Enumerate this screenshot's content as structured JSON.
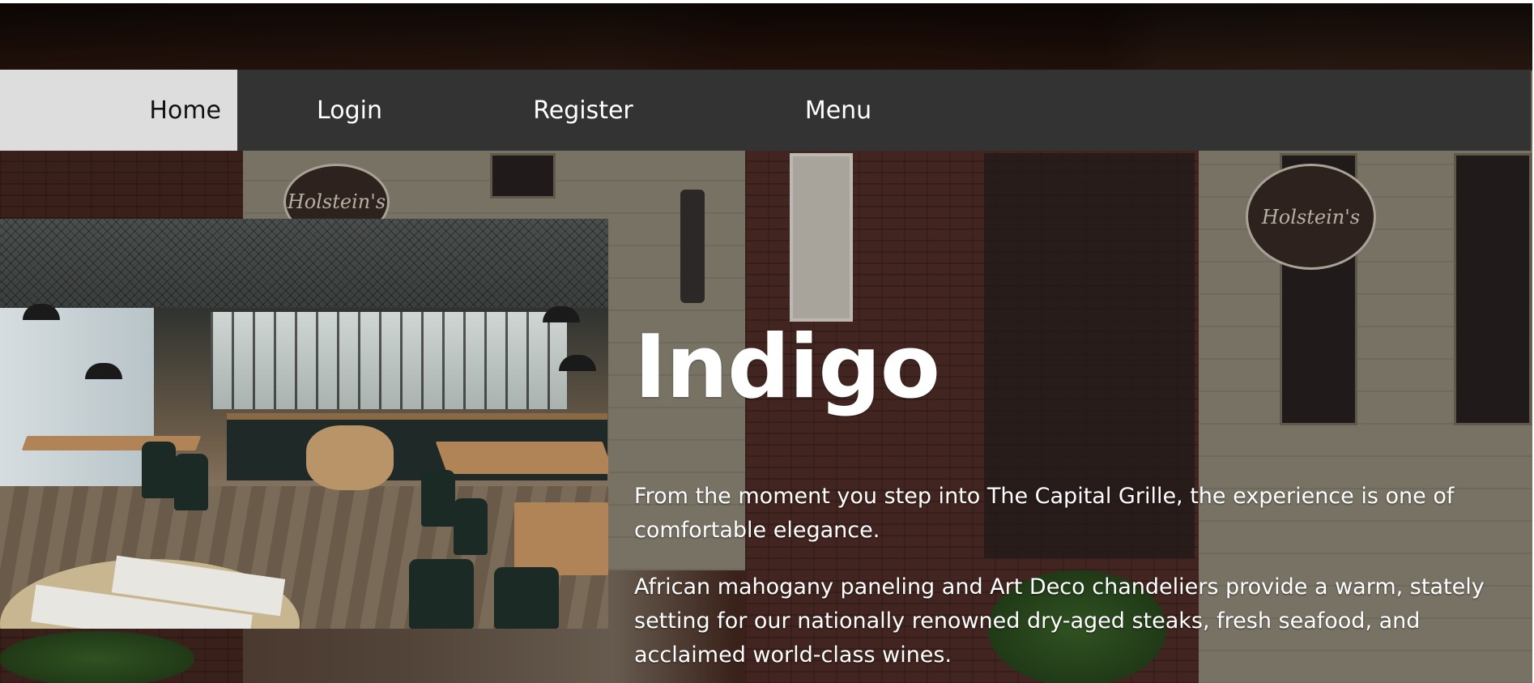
{
  "nav": {
    "items": [
      {
        "label": "Home",
        "active": true
      },
      {
        "label": "Login",
        "active": false
      },
      {
        "label": "Register",
        "active": false
      },
      {
        "label": "Menu",
        "active": false
      }
    ]
  },
  "hero": {
    "title": "Indigo",
    "paragraphs": [
      "From the moment you step into The Capital Grille, the experience is one of comfortable elegance.",
      "African mahogany paneling and Art Deco chandeliers provide a warm, stately setting for our nationally renowned dry-aged steaks, fresh seafood, and acclaimed world-class wines."
    ],
    "sign_text": "Holstein's"
  },
  "colors": {
    "nav_bg": "#333333",
    "nav_active_bg": "#dddddd",
    "nav_text": "#ffffff",
    "nav_active_text": "#111111",
    "hero_text": "#ffffff"
  },
  "icons": {
    "photo": "cafe-interior-photo",
    "background": "street-building-photo"
  }
}
